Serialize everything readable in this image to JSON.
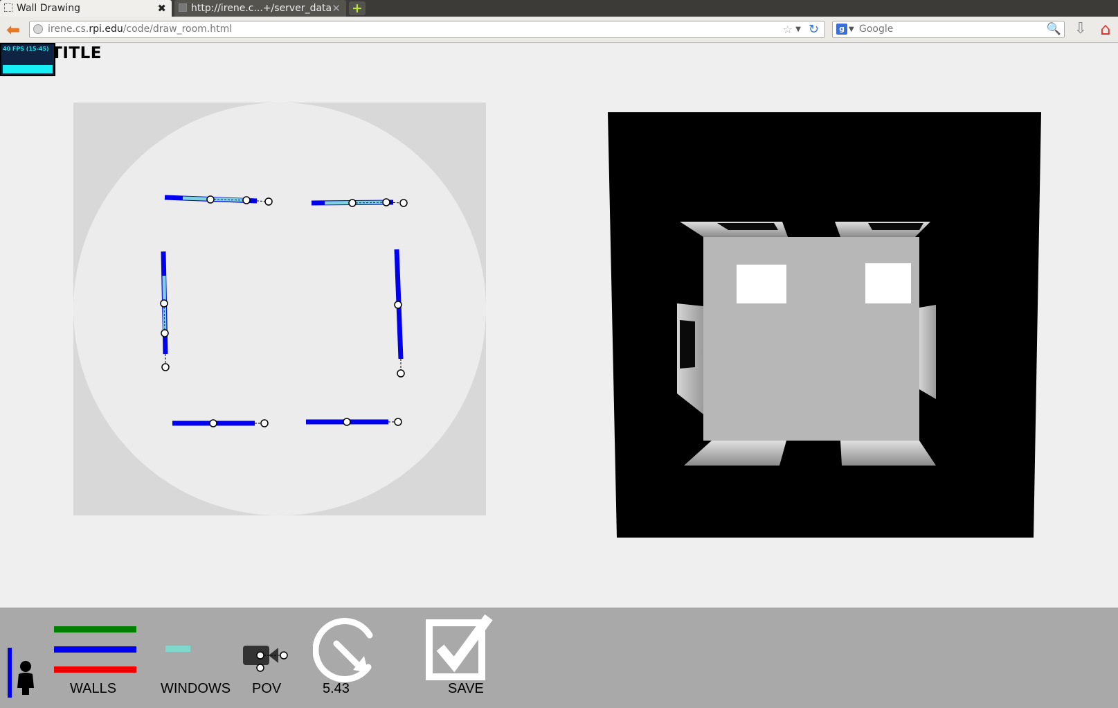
{
  "browser": {
    "tabs": [
      {
        "label": "Wall Drawing",
        "active": true
      },
      {
        "label": "http://irene.c...+/server_data",
        "active": false
      }
    ],
    "new_tab_label": "+",
    "url_host": "irene.cs.",
    "url_domain": "rpi.edu",
    "url_path": "/code/draw_room.html",
    "search_placeholder": "Google",
    "search_engine_icon": "g"
  },
  "page": {
    "title": "TEST TITLE",
    "fps_text": "40 FPS (15-45)"
  },
  "colors": {
    "wall": "#0000ee",
    "window": "#80d0e0",
    "wall_green": "#007f00",
    "wall_red": "#ee0000",
    "window_swatch": "#7fd8cc",
    "toolbar_bg": "#a9a9a9"
  },
  "toolbar": {
    "walls_label": "WALLS",
    "windows_label": "WINDOWS",
    "pov_label": "POV",
    "rotation_value": "5.43",
    "save_label": "SAVE"
  }
}
